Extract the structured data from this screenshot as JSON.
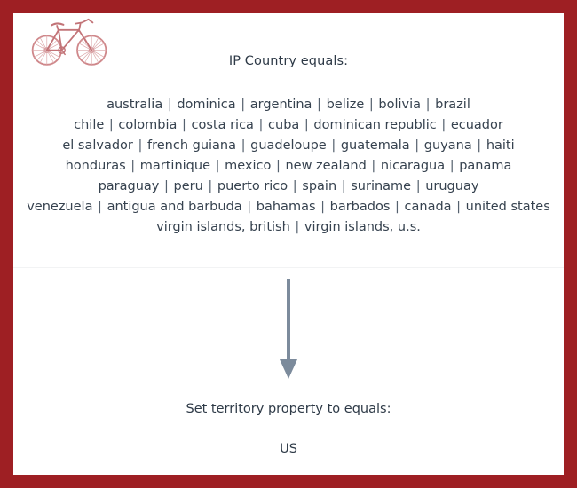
{
  "frame": {
    "border_color": "#9e1f23",
    "background_color": "#ffffff"
  },
  "logo": {
    "name": "bicycle-logo",
    "color": "#bf5a5e"
  },
  "condition": {
    "title": "IP Country equals:",
    "separator": "|",
    "lines": [
      [
        "australia",
        "dominica",
        "argentina",
        "belize",
        "bolivia",
        "brazil"
      ],
      [
        "chile",
        "colombia",
        "costa rica",
        "cuba",
        "dominican republic",
        "ecuador"
      ],
      [
        "el salvador",
        "french guiana",
        "guadeloupe",
        "guatemala",
        "guyana",
        "haiti"
      ],
      [
        "honduras",
        "martinique",
        "mexico",
        "new zealand",
        "nicaragua",
        "panama"
      ],
      [
        "paraguay",
        "peru",
        "puerto rico",
        "spain",
        "suriname",
        "uruguay"
      ],
      [
        "venezuela",
        "antigua and barbuda",
        "bahamas",
        "barbados",
        "canada",
        "united states"
      ],
      [
        "virgin islands, british",
        "virgin islands, u.s."
      ]
    ],
    "text_color": "#36424f"
  },
  "arrow": {
    "name": "downward-arrow",
    "color": "#7c8b9c",
    "direction": "down"
  },
  "action": {
    "title": "Set territory property to equals:",
    "value": "US",
    "text_color": "#2e3a47"
  }
}
